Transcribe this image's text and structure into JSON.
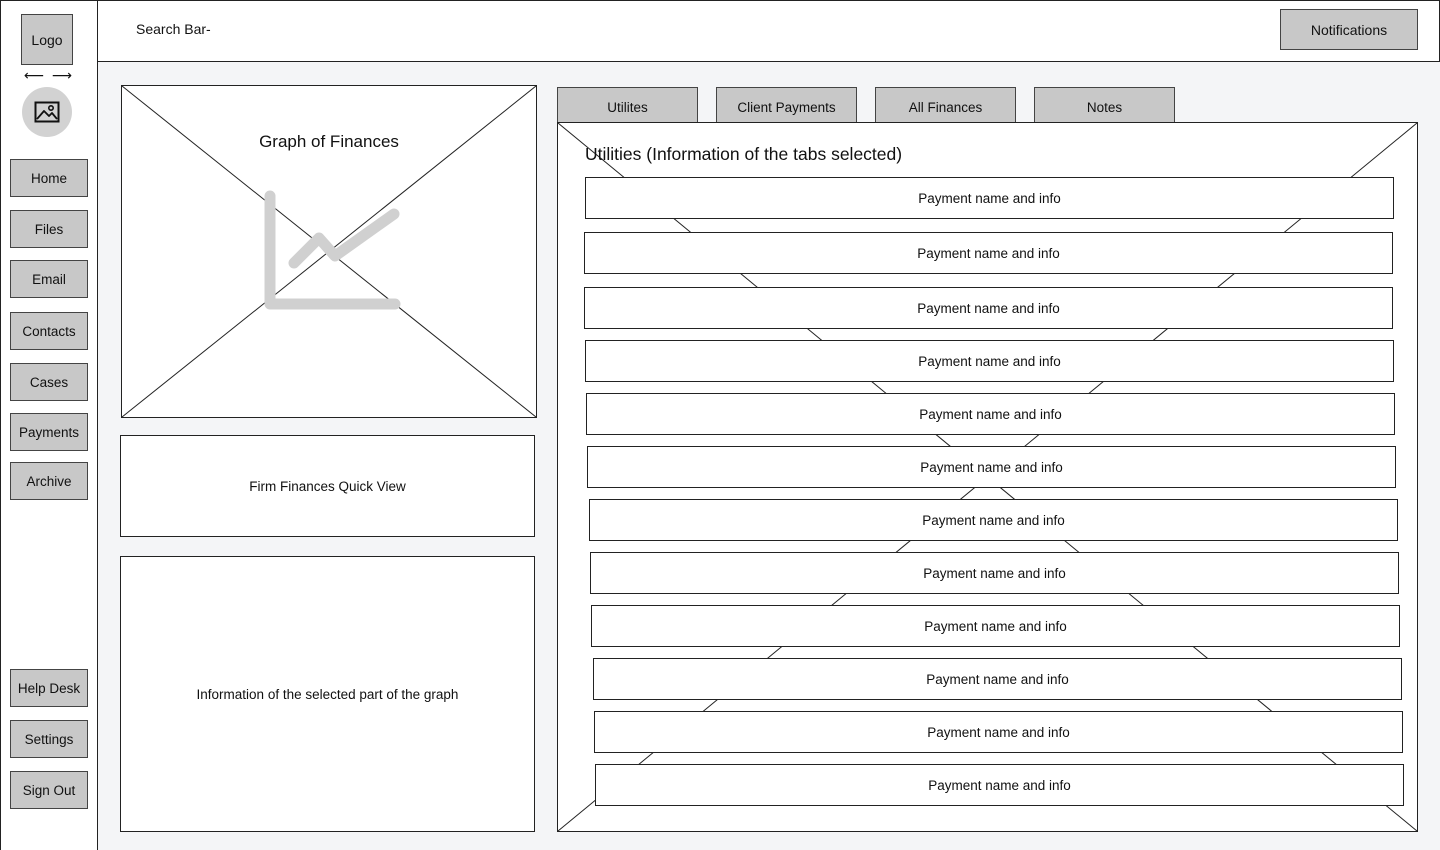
{
  "sidebar": {
    "logo": "Logo",
    "arrow_left": "⟵",
    "arrow_right": "⟶",
    "nav_top": [
      "Home",
      "Files",
      "Email",
      "Contacts",
      "Cases",
      "Payments",
      "Archive"
    ],
    "nav_bottom": [
      "Help Desk",
      "Settings",
      "Sign Out"
    ]
  },
  "header": {
    "search_label": "Search Bar-",
    "notifications": "Notifications"
  },
  "graph": {
    "title": "Graph of Finances",
    "icon": "chart-icon"
  },
  "quick_view": "Firm Finances Quick View",
  "graph_info": "Information of the selected part of the graph",
  "tabs": [
    "Utilites",
    "Client Payments",
    "All Finances",
    "Notes"
  ],
  "content": {
    "title": "Utilities (Information of the tabs selected)",
    "rows": [
      "Payment name and info",
      "Payment name and info",
      "Payment name and info",
      "Payment name and info",
      "Payment name and info",
      "Payment name and info",
      "Payment name and info",
      "Payment name and info",
      "Payment name and info",
      "Payment name and info",
      "Payment name and info",
      "Payment name and info"
    ]
  }
}
